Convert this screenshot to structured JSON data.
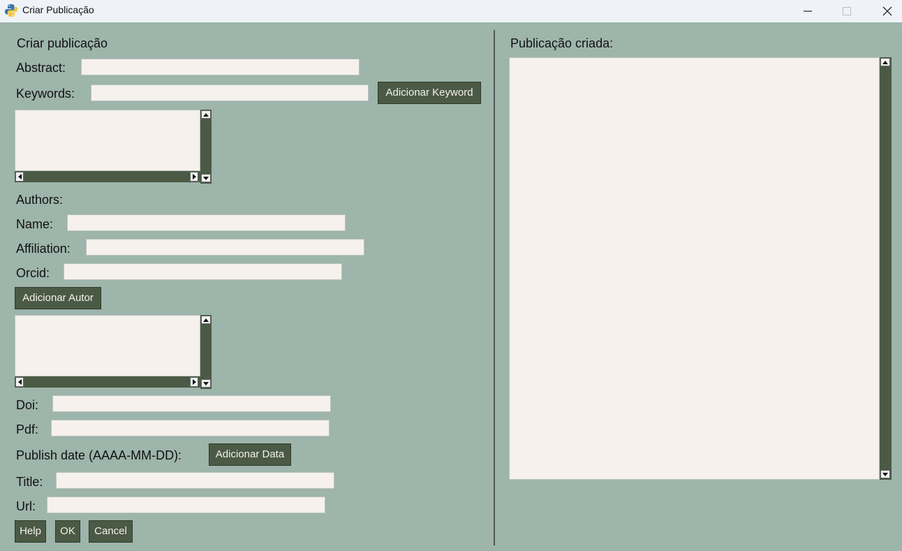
{
  "window": {
    "title": "Criar Publicação"
  },
  "form": {
    "heading": "Criar publicação",
    "abstract_label": "Abstract:",
    "keywords_label": "Keywords:",
    "add_keyword_button": "Adicionar Keyword",
    "authors_label": "Authors:",
    "name_label": "Name:",
    "affiliation_label": "Affiliation:",
    "orcid_label": "Orcid:",
    "add_author_button": "Adicionar Autor",
    "doi_label": "Doi:",
    "pdf_label": "Pdf:",
    "publish_date_label": "Publish date (AAAA-MM-DD):",
    "add_date_button": "Adicionar Data",
    "title_label": "Title:",
    "url_label": "Url:",
    "help_button": "Help",
    "ok_button": "OK",
    "cancel_button": "Cancel"
  },
  "output": {
    "label": "Publicação criada:"
  },
  "colors": {
    "background": "#9db5ab",
    "button": "#4b5a45",
    "field": "#f6f1ec"
  }
}
